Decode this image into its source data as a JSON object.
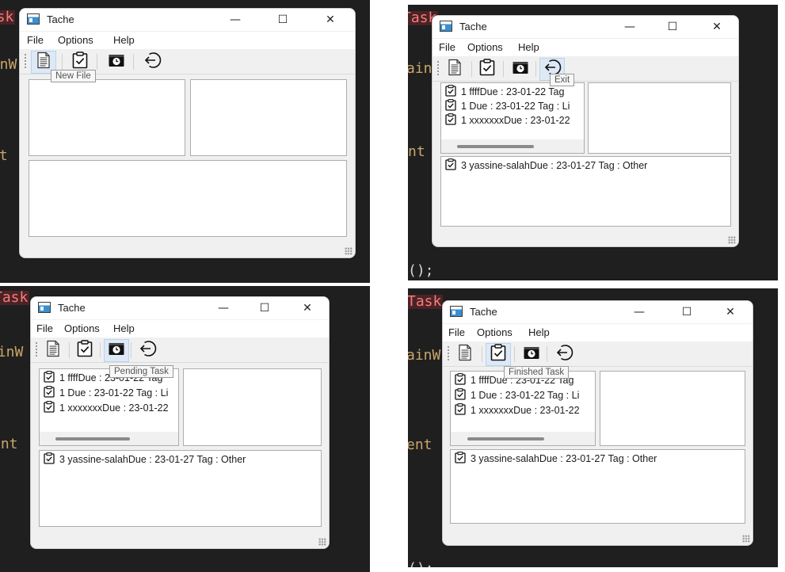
{
  "window": {
    "title": "Tache",
    "minimize_glyph": "—",
    "maximize_glyph": "☐",
    "close_glyph": "✕"
  },
  "menu": [
    "File",
    "Options",
    "Help"
  ],
  "toolbar": [
    {
      "icon": "document-icon",
      "tooltip": "New File"
    },
    {
      "icon": "clipboard-check-icon",
      "tooltip": "Finished Task"
    },
    {
      "icon": "clock-box-icon",
      "tooltip": "Pending Task"
    },
    {
      "icon": "exit-arrow-icon",
      "tooltip": "Exit"
    }
  ],
  "tasks_todo": [
    "1 ffffDue : 23-01-22 Tag",
    "1 Due : 23-01-22 Tag : Li",
    "1 xxxxxxxDue : 23-01-22"
  ],
  "tasks_bottom": [
    "3 yassine-salahDue : 23-01-27 Tag : Other"
  ],
  "code_fragments": {
    "a": "Task",
    "b": "ainW",
    "c": "nt",
    "d": "ent",
    "e": "();",
    "f": "}"
  },
  "colors": {
    "accent_hover": "#dde9f6",
    "editor_bg": "#1f1f1f",
    "keyword": "#f97a7a"
  }
}
